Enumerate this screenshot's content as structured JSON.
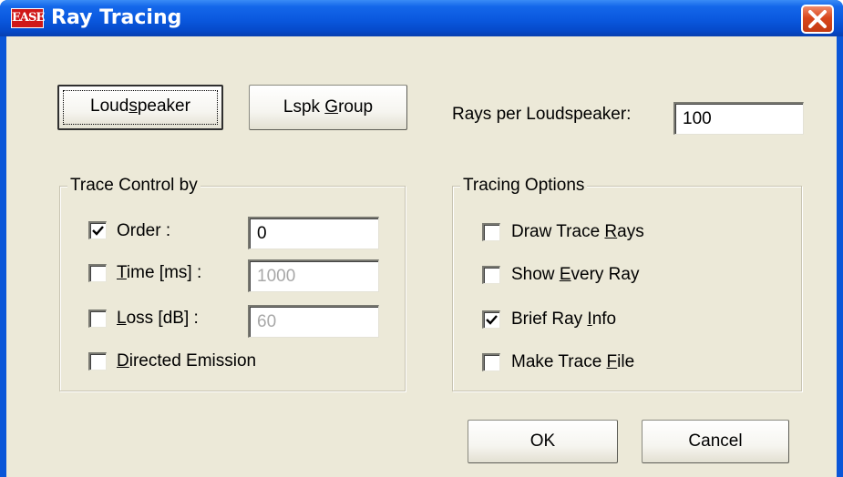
{
  "window": {
    "title": "Ray Tracing",
    "app_icon_text": "EASE",
    "close_icon": "close-x-icon"
  },
  "buttons": {
    "loudspeaker": "Loudspeaker",
    "lspk_group": "Lspk Group",
    "ok": "OK",
    "cancel": "Cancel"
  },
  "rays": {
    "label": "Rays per Loudspeaker:",
    "value": "100"
  },
  "trace_control": {
    "title": "Trace Control by",
    "order": {
      "label": "Order :",
      "checked": true,
      "value": "0",
      "enabled": true
    },
    "time": {
      "label": "Time [ms] :",
      "checked": false,
      "value": "1000",
      "enabled": false
    },
    "loss": {
      "label": "Loss [dB] :",
      "checked": false,
      "value": "60",
      "enabled": false
    },
    "directed": {
      "label": "Directed Emission",
      "checked": false
    }
  },
  "tracing_options": {
    "title": "Tracing Options",
    "draw_trace_rays": {
      "label": "Draw Trace Rays",
      "checked": false
    },
    "show_every_ray": {
      "label": "Show Every Ray",
      "checked": false
    },
    "brief_ray_info": {
      "label": "Brief Ray Info",
      "checked": true
    },
    "make_trace_file": {
      "label": "Make Trace File",
      "checked": false
    }
  },
  "colors": {
    "titlebar": "#0a58de",
    "dialog_bg": "#ece9d8",
    "close_button": "#d8471c"
  }
}
